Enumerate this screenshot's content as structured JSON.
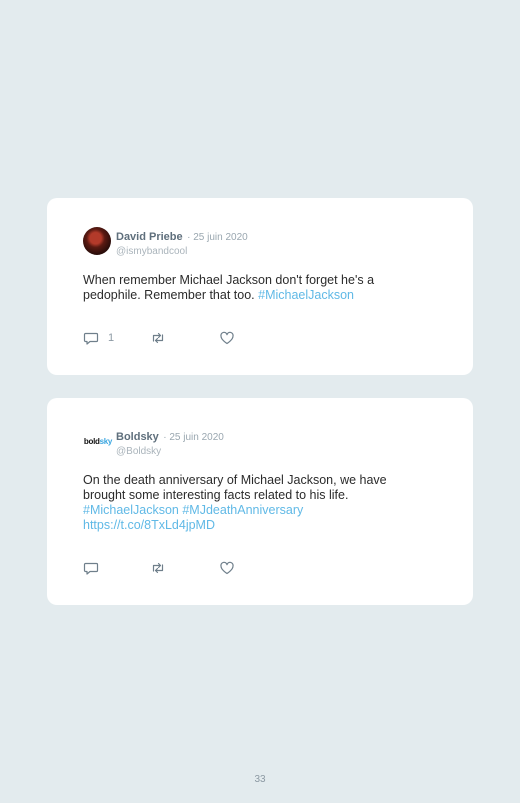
{
  "tweets": [
    {
      "author": "David Priebe",
      "date": "· 25 juin 2020",
      "handle": "@ismybandcool",
      "text_plain": "When remember Michael Jackson don't forget he's a pedophile. Remember that too.",
      "hashtag": "#MichaelJackson",
      "reply_count": "1",
      "avatar_icon": "profile-photo"
    },
    {
      "author": "Boldsky",
      "date": "· 25 juin 2020",
      "handle": "@Boldsky",
      "logo": {
        "bold": "bold",
        "sky": "sky"
      },
      "text_plain": "On the death anniversary of Michael Jackson, we have brought some interesting facts related to his life.",
      "hashtags": "#MichaelJackson #MJdeathAnniversary",
      "link": "https://t.co/8TxLd4jpMD",
      "avatar_icon": "boldsky-logo"
    }
  ],
  "page_number": "33",
  "colors": {
    "background": "#e3ebee",
    "card": "#ffffff",
    "link": "#60b9e6",
    "icon": "#6f7f8b"
  }
}
